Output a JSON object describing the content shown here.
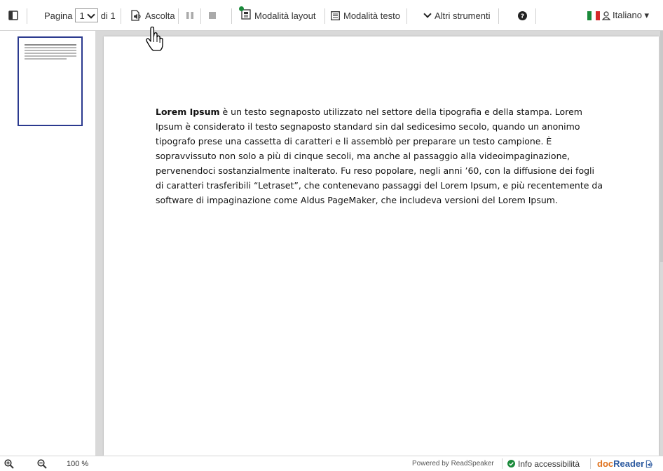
{
  "toolbar": {
    "sidebar_toggle_icon": "sidebar-panel-icon",
    "page_label": "Pagina",
    "page_value": "1",
    "page_of": "di 1",
    "listen_label": "Ascolta",
    "layout_mode_label": "Modalità layout",
    "text_mode_label": "Modalità testo",
    "more_tools_label": "Altri strumenti",
    "help_icon": "help-icon",
    "language_label": "Italiano ▾"
  },
  "document": {
    "bold_lead": "Lorem Ipsum",
    "paragraph": " è un testo segnaposto utilizzato nel settore della tipografia e della stampa. Lorem Ipsum è considerato il testo segnaposto standard sin dal sedicesimo secolo, quando un anonimo tipografo prese una cassetta di caratteri e li assemblò per preparare un testo campione. È sopravvissuto non solo a più di cinque secoli, ma anche al passaggio alla videoimpaginazione, pervenendoci sostanzialmente inalterato. Fu reso popolare, negli anni ’60, con la diffusione dei fogli di caratteri trasferibili “Letraset”, che contenevano passaggi del Lorem Ipsum, e più recentemente da software di impaginazione come Aldus PageMaker, che includeva versioni del Lorem Ipsum."
  },
  "bottom": {
    "zoom_level": "100 %",
    "powered_by": "Powered by ReadSpeaker",
    "accessibility_info": "Info accessibilità",
    "brand_doc": "doc",
    "brand_reader": "Reader"
  },
  "colors": {
    "accent_green": "#1a8a3a",
    "brand_orange": "#e0731f",
    "brand_blue": "#2c5aa0",
    "thumb_border": "#2b3a8f"
  }
}
